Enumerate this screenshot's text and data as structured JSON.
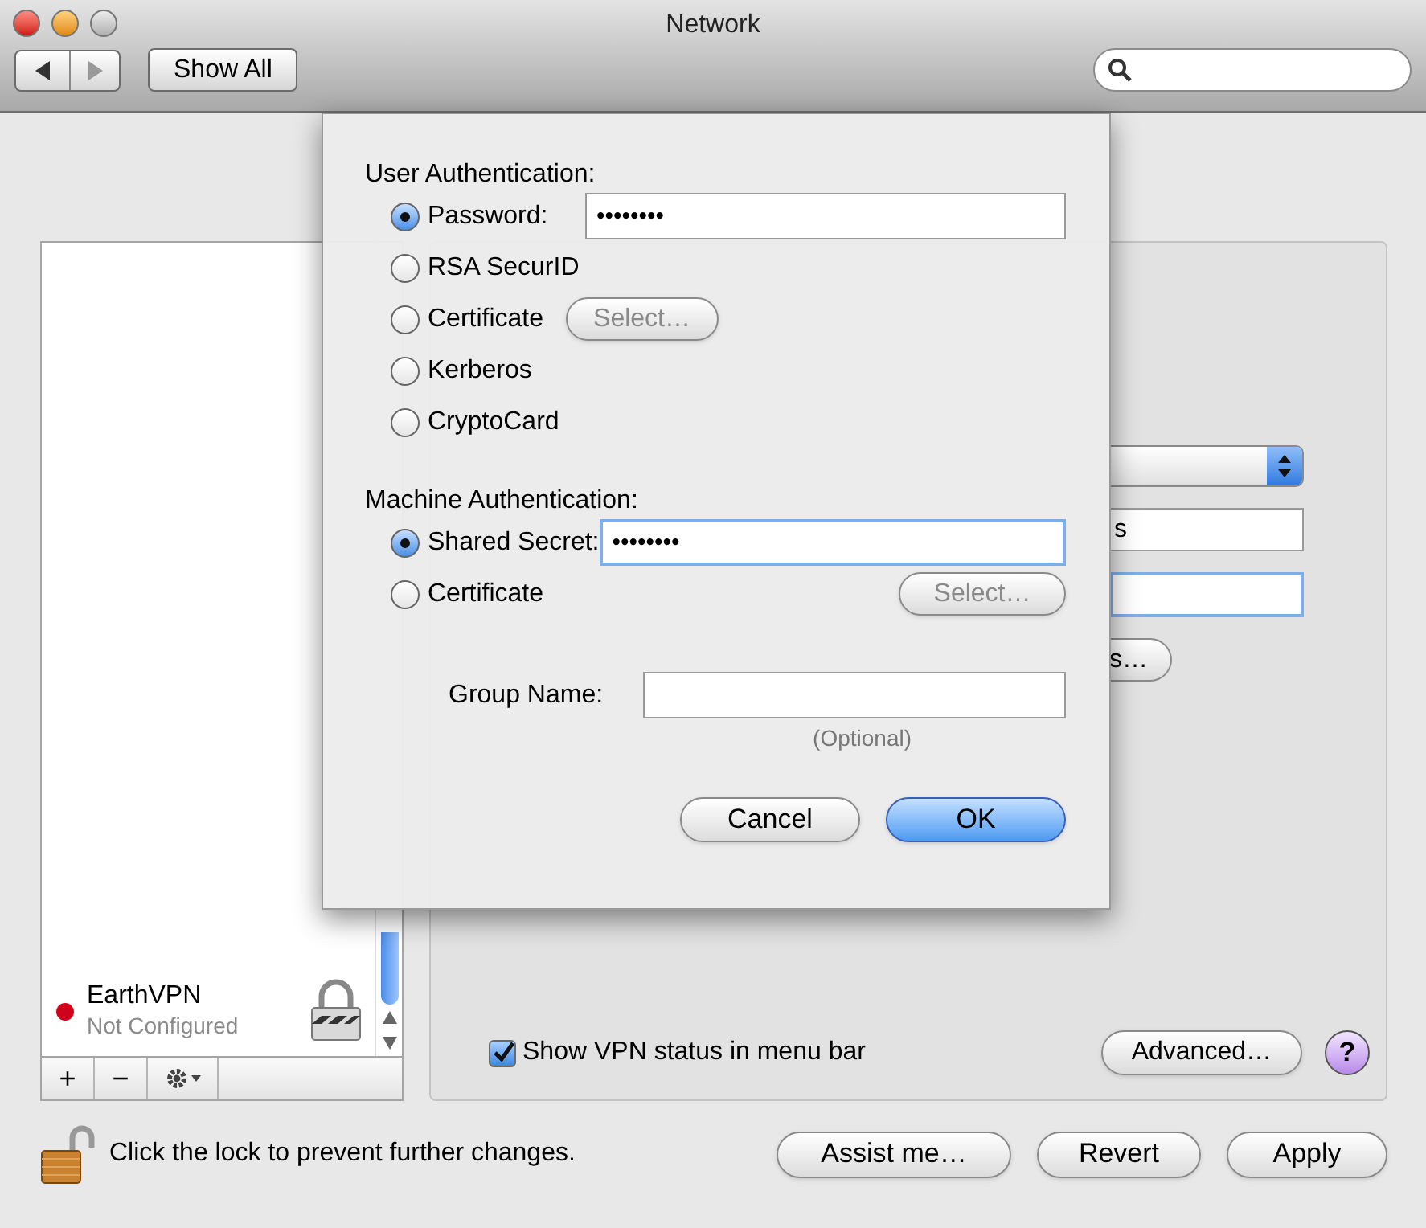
{
  "window": {
    "title": "Network"
  },
  "toolbar": {
    "show_all": "Show All"
  },
  "services": [
    {
      "name": "EarthVPN",
      "status": "Not Configured",
      "color": "#d0021b"
    }
  ],
  "list_buttons": [
    "+",
    "−"
  ],
  "vpn_panel": {
    "server_address_end": "s",
    "auth_button_end": "s…",
    "show_status": {
      "label": "Show VPN status in menu bar",
      "checked": true
    },
    "advanced": "Advanced…",
    "help": "?"
  },
  "lock": {
    "text": "Click the lock to prevent further changes.",
    "locked": false
  },
  "buttons": [
    "Assist me…",
    "Revert",
    "Apply"
  ],
  "sheet": {
    "sections": [
      {
        "title": "User Authentication:",
        "options": [
          {
            "kind": "field",
            "label": "Password:",
            "selected": true,
            "field": {
              "value": "••••••••",
              "focused": false
            }
          },
          {
            "kind": "plain",
            "label": "RSA SecurID",
            "selected": false
          },
          {
            "kind": "select",
            "label": "Certificate",
            "selected": false,
            "button": "Select…"
          },
          {
            "kind": "plain",
            "label": "Kerberos",
            "selected": false
          },
          {
            "kind": "plain",
            "label": "CryptoCard",
            "selected": false
          }
        ]
      },
      {
        "title": "Machine Authentication:",
        "options": [
          {
            "kind": "field",
            "label": "Shared Secret:",
            "selected": true,
            "field": {
              "value": "••••••••",
              "focused": true
            }
          },
          {
            "kind": "select_right",
            "label": "Certificate",
            "selected": false,
            "button": "Select…"
          }
        ]
      }
    ],
    "group_name": {
      "label": "Group Name:",
      "hint": "(Optional)"
    },
    "buttons": [
      {
        "label": "Cancel",
        "default": false
      },
      {
        "label": "OK",
        "default": true
      }
    ]
  }
}
